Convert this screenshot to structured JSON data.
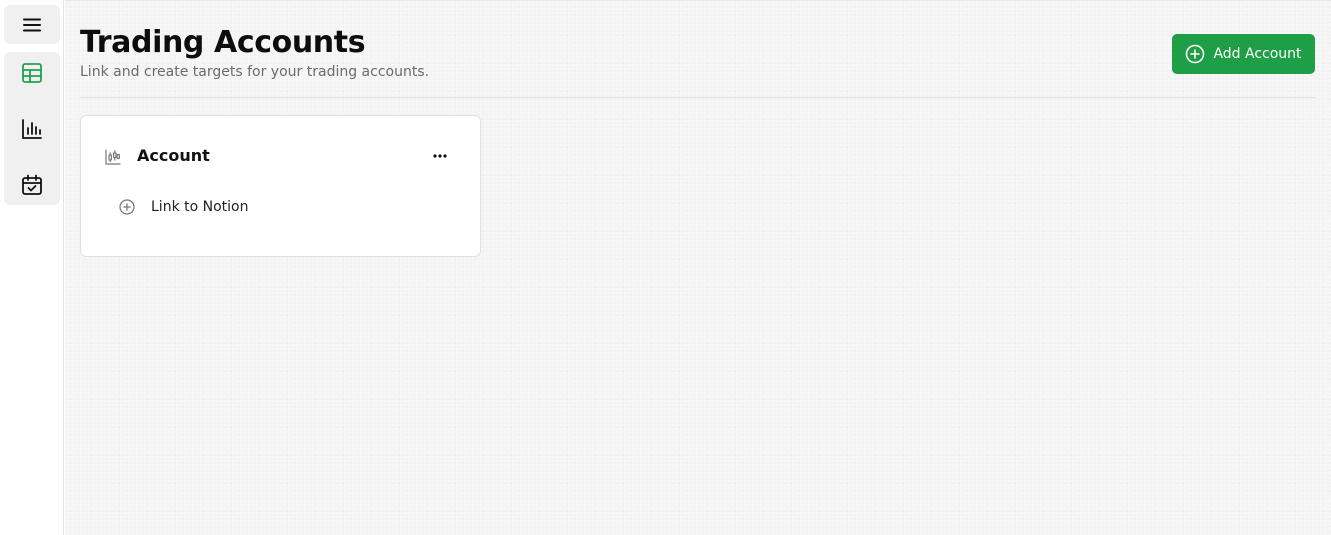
{
  "sidebar": {
    "menu_icon": "hamburger-icon",
    "items": [
      {
        "id": "accounts",
        "icon": "table-icon",
        "active": true
      },
      {
        "id": "analytics",
        "icon": "bar-chart-icon",
        "active": false
      },
      {
        "id": "calendar",
        "icon": "calendar-check-icon",
        "active": false
      }
    ]
  },
  "header": {
    "title": "Trading Accounts",
    "subtitle": "Link and create targets for your trading accounts.",
    "add_button_label": "Add Account"
  },
  "cards": [
    {
      "title": "Account",
      "icon": "candlestick-chart-icon",
      "menu_icon": "more-horizontal-icon",
      "link_label": "Link to Notion",
      "link_icon": "plus-circle-icon"
    }
  ],
  "colors": {
    "accent": "#1e9e45",
    "active_icon": "#22a050",
    "background": "#f6f6f6"
  }
}
